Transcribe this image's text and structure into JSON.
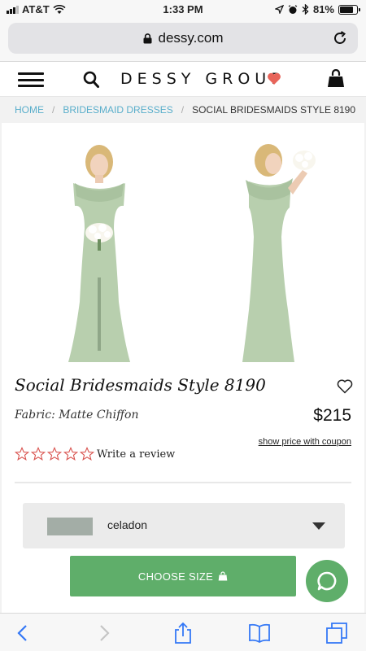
{
  "status_bar": {
    "carrier": "AT&T",
    "time": "1:33 PM",
    "battery_percent": "81%",
    "battery_level": 0.81
  },
  "browser": {
    "url": "dessy.com"
  },
  "header": {
    "logo": "DESSY GROUP",
    "heart_color": "#e8645a"
  },
  "breadcrumb": {
    "home": "HOME",
    "category": "BRIDESMAID DRESSES",
    "current": "SOCIAL BRIDESMAIDS STYLE 8190"
  },
  "product": {
    "title": "Social Bridesmaids Style 8190",
    "fabric": "Fabric: Matte Chiffon",
    "price": "$215",
    "coupon_link": "show price with coupon",
    "rating": 0,
    "rating_max": 5,
    "star_color": "#d9534f",
    "review_link": "Write a review",
    "color_select": {
      "selected": "celadon",
      "swatch": "#a3ada6"
    },
    "choose_size": "CHOOSE SIZE",
    "accent": "#5fae6a",
    "dress_color": "#b8cfae"
  }
}
